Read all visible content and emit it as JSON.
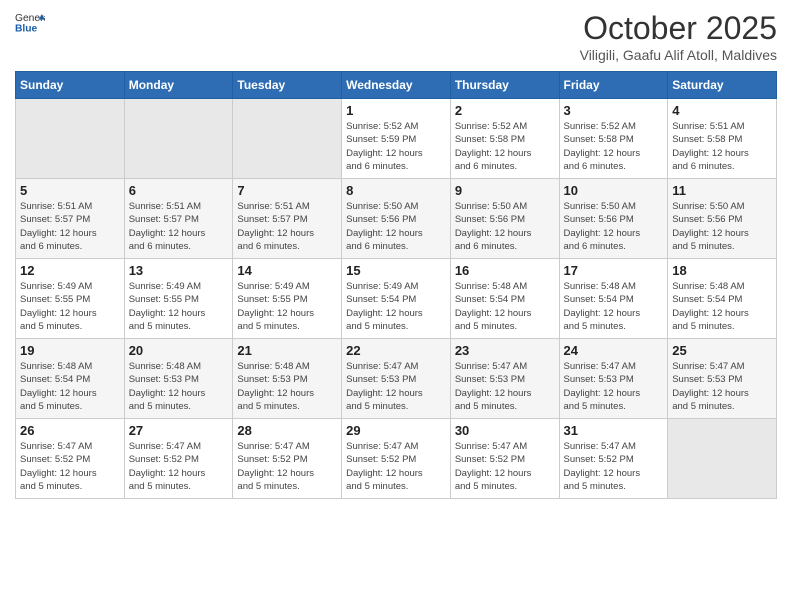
{
  "header": {
    "logo_general": "General",
    "logo_blue": "Blue",
    "title": "October 2025",
    "subtitle": "Viligili, Gaafu Alif Atoll, Maldives"
  },
  "weekdays": [
    "Sunday",
    "Monday",
    "Tuesday",
    "Wednesday",
    "Thursday",
    "Friday",
    "Saturday"
  ],
  "weeks": [
    [
      {
        "day": "",
        "info": ""
      },
      {
        "day": "",
        "info": ""
      },
      {
        "day": "",
        "info": ""
      },
      {
        "day": "1",
        "info": "Sunrise: 5:52 AM\nSunset: 5:59 PM\nDaylight: 12 hours\nand 6 minutes."
      },
      {
        "day": "2",
        "info": "Sunrise: 5:52 AM\nSunset: 5:58 PM\nDaylight: 12 hours\nand 6 minutes."
      },
      {
        "day": "3",
        "info": "Sunrise: 5:52 AM\nSunset: 5:58 PM\nDaylight: 12 hours\nand 6 minutes."
      },
      {
        "day": "4",
        "info": "Sunrise: 5:51 AM\nSunset: 5:58 PM\nDaylight: 12 hours\nand 6 minutes."
      }
    ],
    [
      {
        "day": "5",
        "info": "Sunrise: 5:51 AM\nSunset: 5:57 PM\nDaylight: 12 hours\nand 6 minutes."
      },
      {
        "day": "6",
        "info": "Sunrise: 5:51 AM\nSunset: 5:57 PM\nDaylight: 12 hours\nand 6 minutes."
      },
      {
        "day": "7",
        "info": "Sunrise: 5:51 AM\nSunset: 5:57 PM\nDaylight: 12 hours\nand 6 minutes."
      },
      {
        "day": "8",
        "info": "Sunrise: 5:50 AM\nSunset: 5:56 PM\nDaylight: 12 hours\nand 6 minutes."
      },
      {
        "day": "9",
        "info": "Sunrise: 5:50 AM\nSunset: 5:56 PM\nDaylight: 12 hours\nand 6 minutes."
      },
      {
        "day": "10",
        "info": "Sunrise: 5:50 AM\nSunset: 5:56 PM\nDaylight: 12 hours\nand 6 minutes."
      },
      {
        "day": "11",
        "info": "Sunrise: 5:50 AM\nSunset: 5:56 PM\nDaylight: 12 hours\nand 5 minutes."
      }
    ],
    [
      {
        "day": "12",
        "info": "Sunrise: 5:49 AM\nSunset: 5:55 PM\nDaylight: 12 hours\nand 5 minutes."
      },
      {
        "day": "13",
        "info": "Sunrise: 5:49 AM\nSunset: 5:55 PM\nDaylight: 12 hours\nand 5 minutes."
      },
      {
        "day": "14",
        "info": "Sunrise: 5:49 AM\nSunset: 5:55 PM\nDaylight: 12 hours\nand 5 minutes."
      },
      {
        "day": "15",
        "info": "Sunrise: 5:49 AM\nSunset: 5:54 PM\nDaylight: 12 hours\nand 5 minutes."
      },
      {
        "day": "16",
        "info": "Sunrise: 5:48 AM\nSunset: 5:54 PM\nDaylight: 12 hours\nand 5 minutes."
      },
      {
        "day": "17",
        "info": "Sunrise: 5:48 AM\nSunset: 5:54 PM\nDaylight: 12 hours\nand 5 minutes."
      },
      {
        "day": "18",
        "info": "Sunrise: 5:48 AM\nSunset: 5:54 PM\nDaylight: 12 hours\nand 5 minutes."
      }
    ],
    [
      {
        "day": "19",
        "info": "Sunrise: 5:48 AM\nSunset: 5:54 PM\nDaylight: 12 hours\nand 5 minutes."
      },
      {
        "day": "20",
        "info": "Sunrise: 5:48 AM\nSunset: 5:53 PM\nDaylight: 12 hours\nand 5 minutes."
      },
      {
        "day": "21",
        "info": "Sunrise: 5:48 AM\nSunset: 5:53 PM\nDaylight: 12 hours\nand 5 minutes."
      },
      {
        "day": "22",
        "info": "Sunrise: 5:47 AM\nSunset: 5:53 PM\nDaylight: 12 hours\nand 5 minutes."
      },
      {
        "day": "23",
        "info": "Sunrise: 5:47 AM\nSunset: 5:53 PM\nDaylight: 12 hours\nand 5 minutes."
      },
      {
        "day": "24",
        "info": "Sunrise: 5:47 AM\nSunset: 5:53 PM\nDaylight: 12 hours\nand 5 minutes."
      },
      {
        "day": "25",
        "info": "Sunrise: 5:47 AM\nSunset: 5:53 PM\nDaylight: 12 hours\nand 5 minutes."
      }
    ],
    [
      {
        "day": "26",
        "info": "Sunrise: 5:47 AM\nSunset: 5:52 PM\nDaylight: 12 hours\nand 5 minutes."
      },
      {
        "day": "27",
        "info": "Sunrise: 5:47 AM\nSunset: 5:52 PM\nDaylight: 12 hours\nand 5 minutes."
      },
      {
        "day": "28",
        "info": "Sunrise: 5:47 AM\nSunset: 5:52 PM\nDaylight: 12 hours\nand 5 minutes."
      },
      {
        "day": "29",
        "info": "Sunrise: 5:47 AM\nSunset: 5:52 PM\nDaylight: 12 hours\nand 5 minutes."
      },
      {
        "day": "30",
        "info": "Sunrise: 5:47 AM\nSunset: 5:52 PM\nDaylight: 12 hours\nand 5 minutes."
      },
      {
        "day": "31",
        "info": "Sunrise: 5:47 AM\nSunset: 5:52 PM\nDaylight: 12 hours\nand 5 minutes."
      },
      {
        "day": "",
        "info": ""
      }
    ]
  ]
}
